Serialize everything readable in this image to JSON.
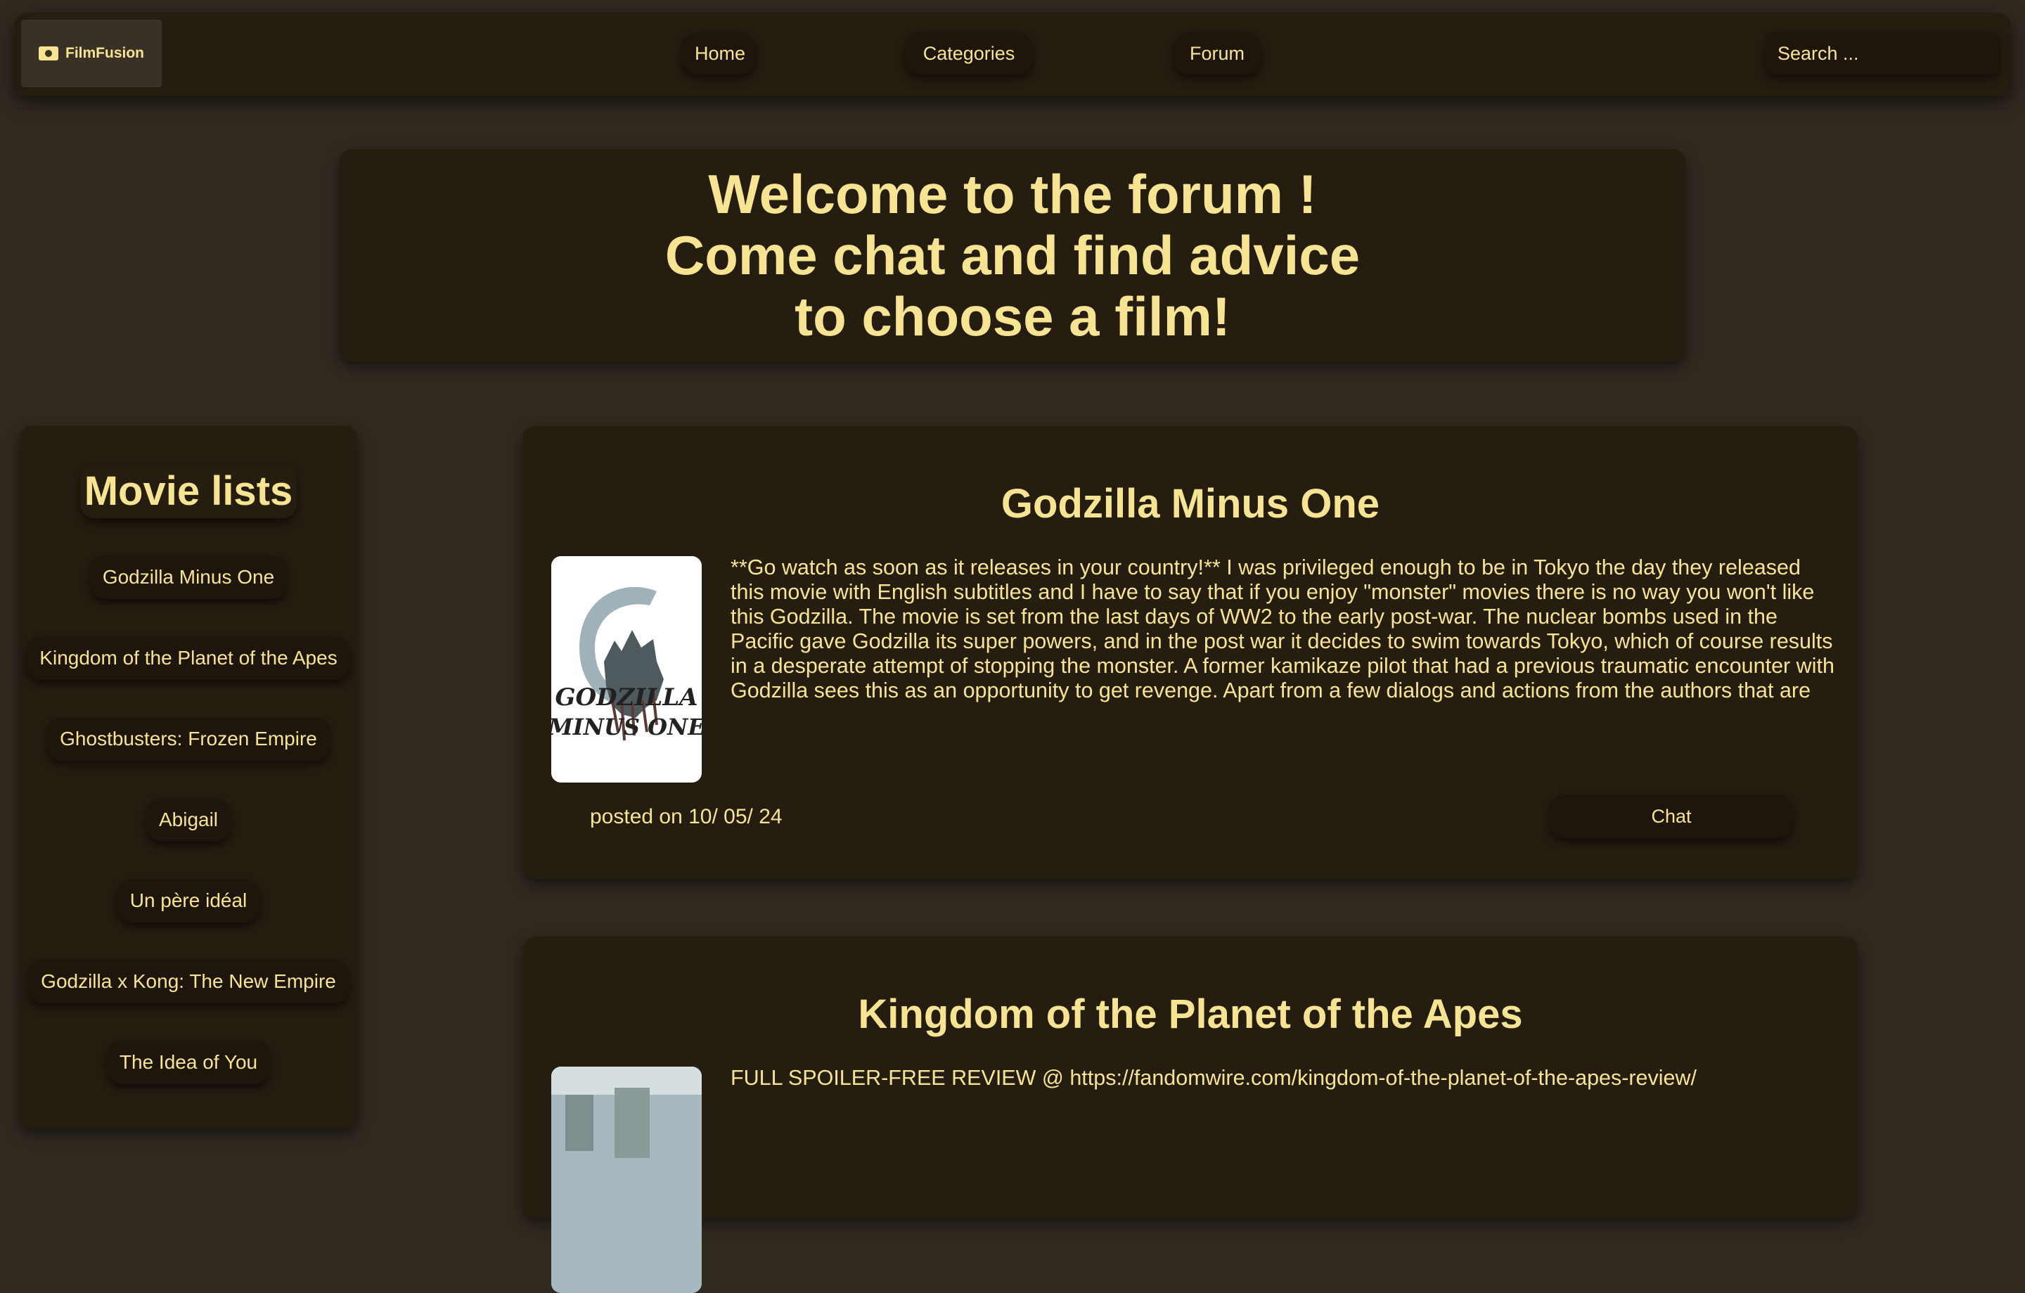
{
  "navbar": {
    "logo_text": "FilmFusion",
    "items": [
      {
        "label": "Home"
      },
      {
        "label": "Categories"
      },
      {
        "label": "Forum"
      }
    ],
    "search_placeholder": "Search ..."
  },
  "welcome": {
    "lines": [
      "Welcome to the forum !",
      "Come chat and find advice",
      "to choose a film!"
    ]
  },
  "sidebar": {
    "title": "Movie lists",
    "items": [
      {
        "label": "Godzilla Minus One"
      },
      {
        "label": "Kingdom of the Planet of the Apes"
      },
      {
        "label": "Ghostbusters: Frozen Empire"
      },
      {
        "label": "Abigail"
      },
      {
        "label": "Un père idéal"
      },
      {
        "label": "Godzilla x Kong: The New Empire"
      },
      {
        "label": "The Idea of You"
      }
    ]
  },
  "posts": [
    {
      "title": "Godzilla Minus One",
      "poster_text": [
        "GODZILLA",
        "MINUS ONE"
      ],
      "text": "**Go watch as soon as it releases in your country!** I was privileged enough to be in Tokyo the day they released this movie with English subtitles and I have to say that if you enjoy \"monster\" movies there is no way you won't like this Godzilla. The movie is set from the last days of WW2 to the early post-war. The nuclear bombs used in the Pacific gave Godzilla its super powers, and in the post war it decides to swim towards Tokyo, which of course results in a desperate attempt of stopping the monster. A former kamikaze pilot that had a previous traumatic encounter with Godzilla sees this as an opportunity to get revenge. Apart from a few dialogs and actions from the authors that are more suitable to the Japanese than the American audience, this movie has it",
      "posted_on": "posted on 10/ 05/ 24",
      "chat_label": "Chat"
    },
    {
      "title": "Kingdom of the Planet of the Apes",
      "text": "FULL SPOILER-FREE REVIEW @ https://fandomwire.com/kingdom-of-the-planet-of-the-apes-review/"
    }
  ],
  "colors": {
    "background": "#302920",
    "panel": "#261d11",
    "button": "#1e160c",
    "accent_text": "#f7e493"
  }
}
